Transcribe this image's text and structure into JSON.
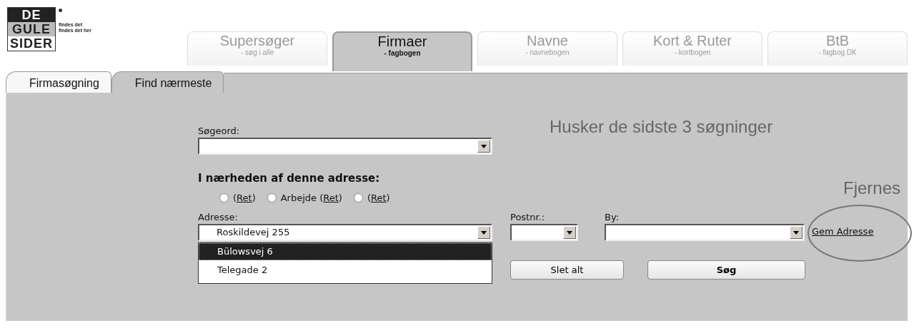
{
  "logo": {
    "lines": [
      "DE",
      "GULE",
      "SIDER"
    ],
    "tagline": [
      "findes det",
      "findes det her"
    ]
  },
  "main_tabs": [
    {
      "label": "Supersøger",
      "sublabel": "- søg i alle",
      "selected": false
    },
    {
      "label": "Firmaer",
      "sublabel": "- fagbogen",
      "selected": true
    },
    {
      "label": "Navne",
      "sublabel": "- navnebogen",
      "selected": false
    },
    {
      "label": "Kort & Ruter",
      "sublabel": "- kortbogen",
      "selected": false
    },
    {
      "label": "BtB",
      "sublabel": "- fagbog DK",
      "selected": false
    }
  ],
  "sub_tabs": [
    {
      "label": "Firmasøgning",
      "selected": false
    },
    {
      "label": "Find nærmeste",
      "selected": true
    }
  ],
  "form": {
    "search_label": "Søgeord:",
    "heading": "I nærheden af denne adresse:",
    "radios": [
      {
        "prefix": "(",
        "link": "Ret",
        "suffix": ")",
        "checked": false
      },
      {
        "prefix": "Arbejde (",
        "link": "Ret",
        "suffix": ")",
        "checked": false
      },
      {
        "prefix": "(",
        "link": "Ret",
        "suffix": ")",
        "checked": false
      }
    ],
    "address_label": "Adresse:",
    "address_value": "Roskildevej 255",
    "address_options": [
      {
        "text": "Bülowsvej 6",
        "selected": true
      },
      {
        "text": "Telegade 2",
        "selected": false
      }
    ],
    "postnr_label": "Postnr.:",
    "by_label": "By:",
    "save_link": "Gem Adresse",
    "remember_text": "Husker de sidste 3 søgninger",
    "remove_text": "Fjernes",
    "buttons": [
      {
        "label": "Slet alt",
        "kind": "secondary"
      },
      {
        "label": "Søg",
        "kind": "primary"
      }
    ]
  }
}
